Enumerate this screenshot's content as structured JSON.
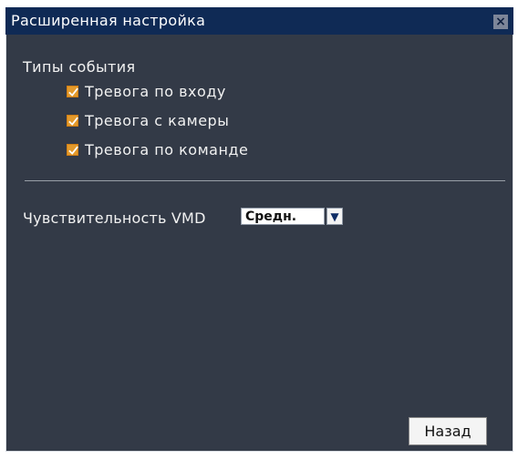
{
  "window": {
    "title": "Расширенная настройка",
    "close_icon": "close-icon",
    "close_glyph": "×"
  },
  "event_types": {
    "label": "Типы события",
    "items": [
      {
        "label": "Тревога по входу",
        "checked": true
      },
      {
        "label": "Тревога с камеры",
        "checked": true
      },
      {
        "label": "Тревога по команде",
        "checked": true
      }
    ]
  },
  "vmd": {
    "label": "Чувствительность VMD",
    "value": "Средн.",
    "dropdown_icon": "dropdown-arrow-icon",
    "dropdown_glyph": "▼"
  },
  "buttons": {
    "back": "Назад"
  },
  "colors": {
    "titlebar": "#0f2a55",
    "panel": "#333a47",
    "checkbox": "#e39a2c"
  }
}
